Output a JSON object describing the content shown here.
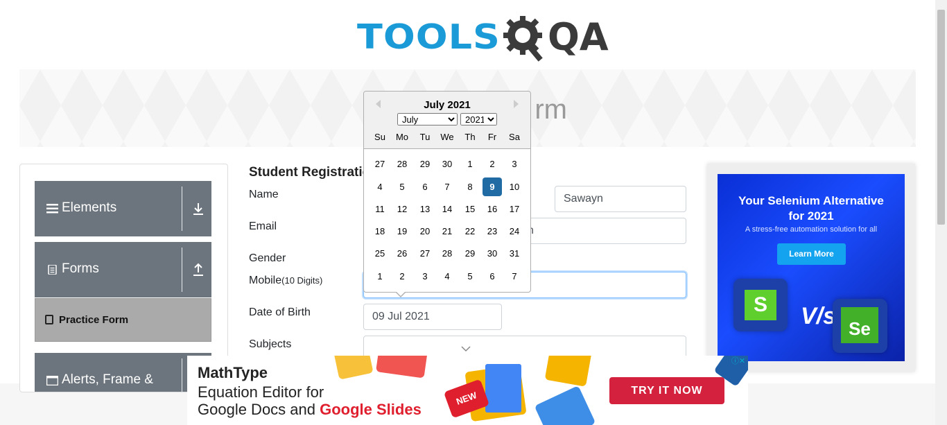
{
  "logo": {
    "tools": "TOOLS",
    "qa": "QA"
  },
  "banner": {
    "title": "rm"
  },
  "nav": {
    "groups": [
      {
        "label": "Elements",
        "arrow": "download-arrow"
      },
      {
        "label": "Forms",
        "arrow": "upload-arrow"
      },
      {
        "label": "Alerts, Frame &"
      }
    ],
    "active_item": "Practice Form"
  },
  "form": {
    "title": "Student Registratio",
    "name_label": "Name",
    "name_last_value": "Sawayn",
    "email_label": "Email",
    "email_value_tail": "n",
    "gender_label": "Gender",
    "mobile_label": "Mobile",
    "mobile_hint": "(10 Digits)",
    "dob_label": "Date of Birth",
    "dob_value": "09 Jul 2021",
    "subjects_label": "Subjects"
  },
  "datepicker": {
    "current": "July 2021",
    "month_select": "July",
    "year_select": "2021",
    "day_names": [
      "Su",
      "Mo",
      "Tu",
      "We",
      "Th",
      "Fr",
      "Sa"
    ],
    "weeks": [
      [
        "27",
        "28",
        "29",
        "30",
        "1",
        "2",
        "3"
      ],
      [
        "4",
        "5",
        "6",
        "7",
        "8",
        "9",
        "10"
      ],
      [
        "11",
        "12",
        "13",
        "14",
        "15",
        "16",
        "17"
      ],
      [
        "18",
        "19",
        "20",
        "21",
        "22",
        "23",
        "24"
      ],
      [
        "25",
        "26",
        "27",
        "28",
        "29",
        "30",
        "31"
      ],
      [
        "1",
        "2",
        "3",
        "4",
        "5",
        "6",
        "7"
      ]
    ],
    "selected": "9"
  },
  "right_ad": {
    "headline_1": "Your Selenium Alternative",
    "headline_2": "for 2021",
    "sub": "A stress-free automation solution for all",
    "button": "Learn More",
    "left_logo": "S",
    "vs": "V/s",
    "right_logo": "Se"
  },
  "bottom_ad": {
    "brand": "MathType",
    "line1": "Equation Editor for",
    "line2_a": "Google Docs and ",
    "line2_b": "Google Slides",
    "badge": "NEW",
    "cta": "TRY IT NOW",
    "adchoice": "ⓘ✕"
  },
  "colors": {
    "logo_blue": "#1a9bd7",
    "nav_bg": "#6c757d",
    "selected_day": "#216ba5",
    "cta_red": "#d4213d",
    "ad_blue": "#0a2fd6"
  }
}
